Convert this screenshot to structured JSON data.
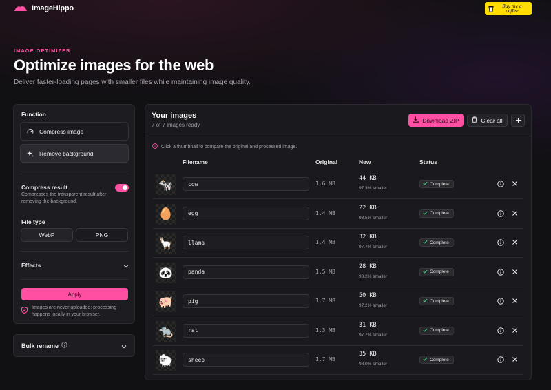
{
  "header": {
    "brand_name": "ImageHippo",
    "coffee_label": "Buy me a coffee"
  },
  "hero": {
    "eyebrow": "IMAGE OPTIMIZER",
    "title": "Optimize images for the web",
    "subtitle": "Deliver faster-loading pages with smaller files while maintaining image quality."
  },
  "sidebar": {
    "function_label": "Function",
    "functions": [
      {
        "label": "Compress image",
        "icon": "gauge-icon",
        "active": false
      },
      {
        "label": "Remove background",
        "icon": "sparkles-icon",
        "active": true
      }
    ],
    "compress_result": {
      "label": "Compress result",
      "description": "Compresses the transparent result after removing the background.",
      "enabled": true
    },
    "file_type": {
      "label": "File type",
      "options": [
        "WebP",
        "PNG"
      ],
      "selected": "WebP"
    },
    "effects_label": "Effects",
    "apply_label": "Apply",
    "privacy_note": "Images are never uploaded; processing happens locally in your browser."
  },
  "bulk_rename": {
    "label": "Bulk rename"
  },
  "images_panel": {
    "title": "Your images",
    "subtitle": "7 of 7 images ready",
    "download_label": "Download ZIP",
    "clear_label": "Clear all",
    "hint": "Click a thumbnail to compare the original and processed image.",
    "columns": [
      "Filename",
      "Original",
      "New",
      "Status"
    ],
    "rows": [
      {
        "filename": "cow",
        "original": "1.6 MB",
        "new": "44 KB",
        "saving": "97.3% smaller",
        "status": "Complete",
        "emoji": "🐄"
      },
      {
        "filename": "egg",
        "original": "1.4 MB",
        "new": "22 KB",
        "saving": "98.5% smaller",
        "status": "Complete",
        "emoji": "🥚"
      },
      {
        "filename": "llama",
        "original": "1.4 MB",
        "new": "32 KB",
        "saving": "97.7% smaller",
        "status": "Complete",
        "emoji": "🦙"
      },
      {
        "filename": "panda",
        "original": "1.5 MB",
        "new": "28 KB",
        "saving": "98.2% smaller",
        "status": "Complete",
        "emoji": "🐼"
      },
      {
        "filename": "pig",
        "original": "1.7 MB",
        "new": "50 KB",
        "saving": "97.2% smaller",
        "status": "Complete",
        "emoji": "🐖"
      },
      {
        "filename": "rat",
        "original": "1.3 MB",
        "new": "31 KB",
        "saving": "97.7% smaller",
        "status": "Complete",
        "emoji": "🐀"
      },
      {
        "filename": "sheep",
        "original": "1.7 MB",
        "new": "35 KB",
        "saving": "98.0% smaller",
        "status": "Complete",
        "emoji": "🐑"
      }
    ]
  },
  "colors": {
    "accent": "#ff4fa3",
    "coffee": "#ffdd00",
    "background": "#111013",
    "panel": "#1d1c20"
  }
}
